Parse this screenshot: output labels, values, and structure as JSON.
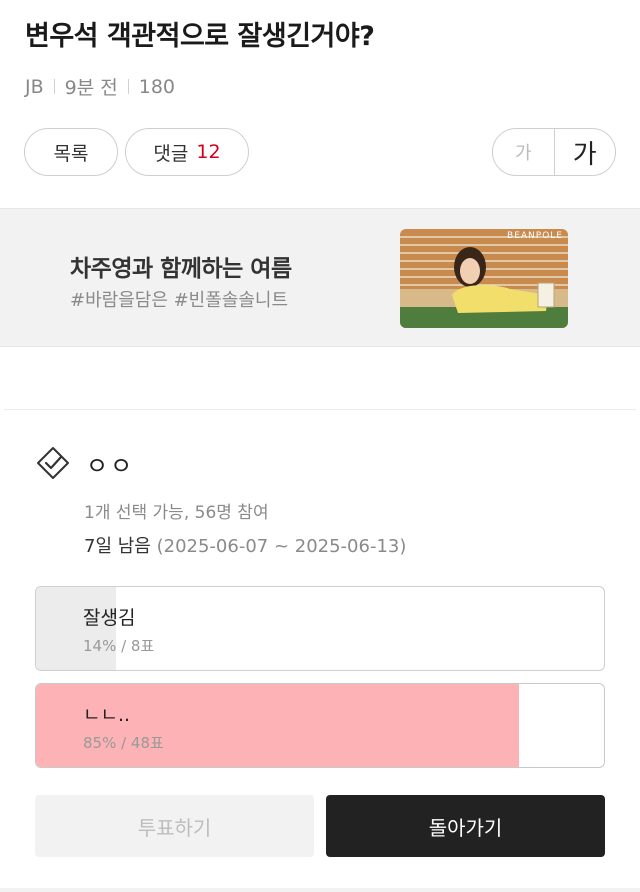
{
  "post": {
    "title": "변우석 객관적으로 잘생긴거야?",
    "author": "JB",
    "time": "9분 전",
    "views": "180"
  },
  "actions": {
    "list_label": "목록",
    "comment_label": "댓글",
    "comment_count": "12",
    "font_small": "가",
    "font_large": "가"
  },
  "ad": {
    "title": "차주영과 함께하는 여름",
    "tags": "#바람을담은 #빈폴솔솔니트",
    "brand": "BEANPOLE"
  },
  "poll": {
    "icon": "check-box-icon",
    "title": "ㅇㅇ",
    "info": "1개 선택 가능, 56명 참여",
    "remaining": "7일 남음",
    "period": "(2025-06-07 ~ 2025-06-13)",
    "options": [
      {
        "label": "잘생김",
        "stat": "14% / 8표",
        "percent": 14,
        "fill_color": "#ececec"
      },
      {
        "label": "ㄴㄴ..",
        "stat": "85% / 48표",
        "percent": 85,
        "fill_color": "#fdb3b5"
      }
    ],
    "vote_label": "투표하기",
    "back_label": "돌아가기"
  }
}
